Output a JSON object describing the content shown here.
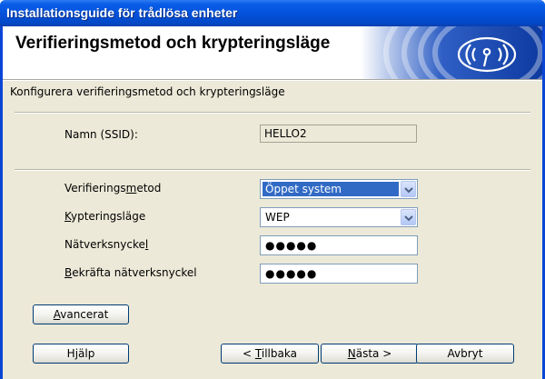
{
  "window": {
    "title": "Installationsguide för trådlösa enheter"
  },
  "header": {
    "heading": "Verifieringsmetod och krypteringsläge"
  },
  "subtitle": "Konfigurera verifieringsmetod och krypteringsläge",
  "form": {
    "ssid": {
      "label": "Namn (SSID):",
      "value": "HELLO2"
    },
    "auth_method": {
      "label_pre": "Verifierings",
      "label_key": "m",
      "label_post": "etod",
      "value": "Öppet system"
    },
    "encryption": {
      "label_pre": "",
      "label_key": "K",
      "label_post": "ypteringsläge",
      "value": "WEP"
    },
    "network_key": {
      "label_pre": "Nätverksnycke",
      "label_key": "l",
      "label_post": "",
      "value": "●●●●●"
    },
    "confirm_key": {
      "label_pre": "",
      "label_key": "B",
      "label_post": "ekräfta nätverksnyckel",
      "value": "●●●●●"
    }
  },
  "buttons": {
    "advanced": {
      "pre": "",
      "key": "A",
      "post": "vancerat"
    },
    "help": {
      "pre": "H",
      "key": "j",
      "post": "älp"
    },
    "back": {
      "pre": "< ",
      "key": "T",
      "post": "illbaka"
    },
    "next": {
      "pre": "",
      "key": "N",
      "post": "ästa >"
    },
    "cancel": {
      "pre": "Avbryt",
      "key": "",
      "post": ""
    }
  },
  "colors": {
    "titlebar": "#0452dc",
    "client_bg": "#ece9d8",
    "selection": "#316ac5",
    "banner_blue": "#1a4fb4"
  },
  "icons": {
    "banner": "wireless-signal-icon",
    "dropdown": "chevron-down-icon"
  }
}
